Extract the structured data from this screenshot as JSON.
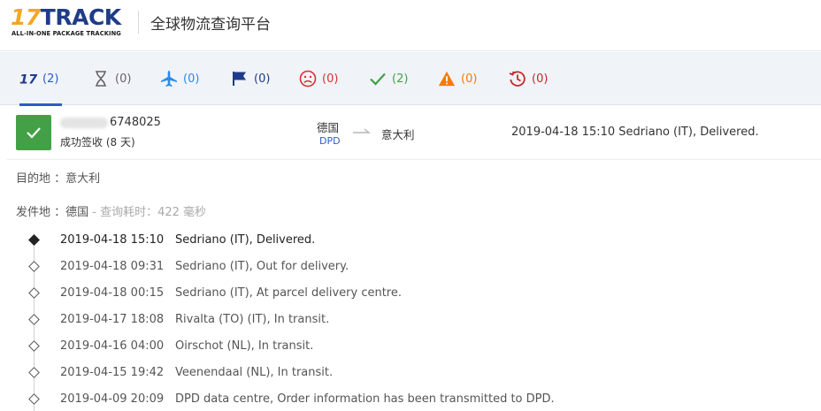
{
  "header": {
    "logo_main_17": "17",
    "logo_main_track": "TRACK",
    "logo_sub": "ALL-IN-ONE PACKAGE TRACKING",
    "title": "全球物流查询平台"
  },
  "tabs": [
    {
      "name": "all",
      "icon": "17track-icon",
      "count": "(2)",
      "color": "#2c5cc5"
    },
    {
      "name": "pending",
      "icon": "hourglass-icon",
      "count": "(0)",
      "color": "#666666"
    },
    {
      "name": "in-transit",
      "icon": "airplane-icon",
      "count": "(0)",
      "color": "#2c8ae8"
    },
    {
      "name": "pick-up",
      "icon": "flag-icon",
      "count": "(0)",
      "color": "#1f3c88"
    },
    {
      "name": "undelivered",
      "icon": "sad-face-icon",
      "count": "(0)",
      "color": "#d9302f"
    },
    {
      "name": "delivered",
      "icon": "checkmark-icon",
      "count": "(2)",
      "color": "#43a047"
    },
    {
      "name": "alert",
      "icon": "warning-icon",
      "count": "(0)",
      "color": "#f57c00"
    },
    {
      "name": "expired",
      "icon": "history-icon",
      "count": "(0)",
      "color": "#c62828"
    }
  ],
  "result": {
    "tracking_suffix": "6748025",
    "status": "成功签收 (8 天)",
    "origin_country": "德国",
    "carrier": "DPD",
    "destination_country": "意大利",
    "last_event": "2019-04-18 15:10  Sedriano (IT), Delivered."
  },
  "destination": {
    "label": "目的地 ：",
    "value": "意大利"
  },
  "origin": {
    "label": "发件地 ：",
    "value": "德国",
    "extra": " - 查询耗时：422 毫秒"
  },
  "events": [
    {
      "time": "2019-04-18 15:10",
      "desc": "Sedriano (IT), Delivered."
    },
    {
      "time": "2019-04-18 09:31",
      "desc": "Sedriano (IT), Out for delivery."
    },
    {
      "time": "2019-04-18 00:15",
      "desc": "Sedriano (IT), At parcel delivery centre."
    },
    {
      "time": "2019-04-17 18:08",
      "desc": "Rivalta (TO) (IT), In transit."
    },
    {
      "time": "2019-04-16 04:00",
      "desc": "Oirschot (NL), In transit."
    },
    {
      "time": "2019-04-15 19:42",
      "desc": "Veenendaal (NL), In transit."
    },
    {
      "time": "2019-04-09 20:09",
      "desc": "DPD data centre, Order information has been transmitted to DPD."
    }
  ]
}
